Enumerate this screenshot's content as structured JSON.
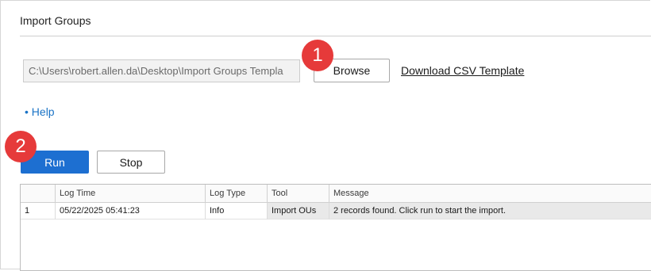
{
  "page": {
    "title": "Import Groups"
  },
  "file_picker": {
    "path_value": "C:\\Users\\robert.allen.da\\Desktop\\Import Groups Templa",
    "browse_label": "Browse",
    "download_label": "Download CSV Template"
  },
  "help": {
    "label": "• Help"
  },
  "controls": {
    "run_label": "Run",
    "stop_label": "Stop"
  },
  "steps": {
    "step1": "1",
    "step2": "2"
  },
  "colors": {
    "primary": "#1d6fd1",
    "badge": "#e63a3a",
    "link": "#1a73c6"
  },
  "log_table": {
    "columns": [
      "",
      "Log Time",
      "Log Type",
      "Tool",
      "Message"
    ],
    "rows": [
      [
        "1",
        "05/22/2025 05:41:23",
        "Info",
        "Import OUs",
        "2 records found. Click run to start the import."
      ]
    ]
  }
}
